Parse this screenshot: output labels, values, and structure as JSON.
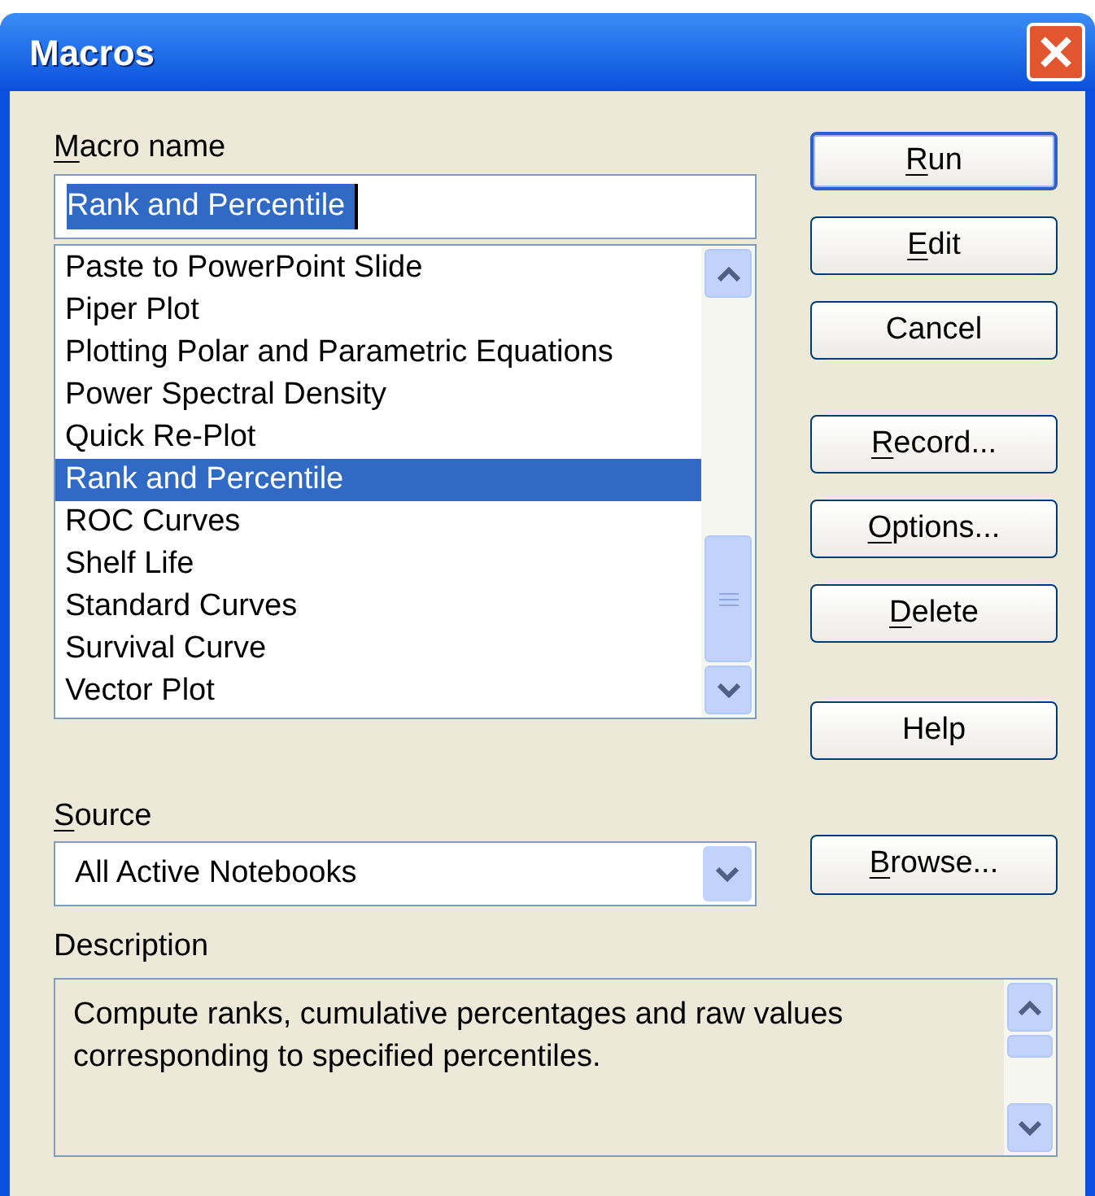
{
  "window": {
    "title": "Macros"
  },
  "macro_name": {
    "label": "Macro name",
    "access_key": true,
    "value": "Rank and Percentile"
  },
  "macros": [
    {
      "label": "Paste to PowerPoint Slide",
      "selected": false
    },
    {
      "label": "Piper Plot",
      "selected": false
    },
    {
      "label": "Plotting Polar and Parametric Equations",
      "selected": false
    },
    {
      "label": "Power Spectral Density",
      "selected": false
    },
    {
      "label": "Quick Re-Plot",
      "selected": false
    },
    {
      "label": "Rank and Percentile",
      "selected": true
    },
    {
      "label": "ROC Curves",
      "selected": false
    },
    {
      "label": "Shelf Life",
      "selected": false
    },
    {
      "label": "Standard Curves",
      "selected": false
    },
    {
      "label": "Survival Curve",
      "selected": false
    },
    {
      "label": "Vector Plot",
      "selected": false
    }
  ],
  "buttons": [
    {
      "label": "Run",
      "access_key": true,
      "default": true
    },
    {
      "label": "Edit",
      "access_key": true,
      "default": false
    },
    {
      "label": "Cancel",
      "access_key": false,
      "default": false
    },
    {
      "label": "Record...",
      "access_key": true,
      "default": false
    },
    {
      "label": "Options...",
      "access_key": true,
      "default": false
    },
    {
      "label": "Delete",
      "access_key": true,
      "default": false
    },
    {
      "label": "Help",
      "access_key": false,
      "default": false
    }
  ],
  "source": {
    "label": "Source",
    "access_key": true,
    "value": "All Active Notebooks"
  },
  "browse_button": {
    "label": "Browse...",
    "access_key": true
  },
  "description": {
    "label": "Description",
    "text": "Compute ranks, cumulative percentages and raw values corresponding to specified percentiles."
  }
}
